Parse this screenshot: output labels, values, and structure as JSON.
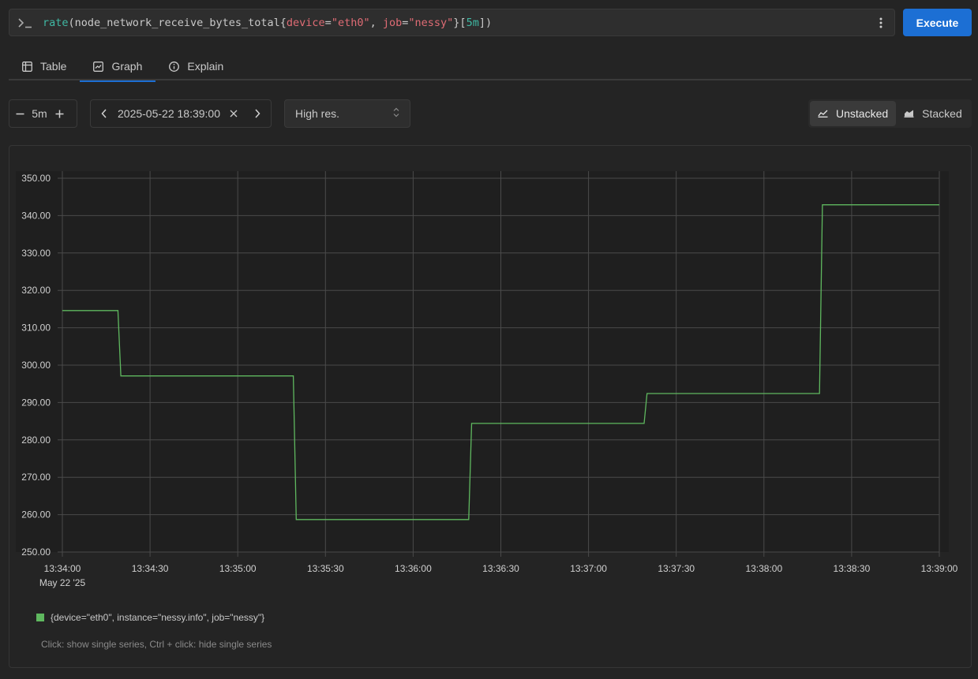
{
  "query": {
    "fn": "rate",
    "metric": "node_network_receive_bytes_total",
    "label1_key": "device",
    "label1_val": "\"eth0\"",
    "label2_key": "job",
    "label2_val": "\"nessy\"",
    "range": "5m"
  },
  "execute_label": "Execute",
  "tabs": [
    {
      "label": "Table",
      "icon": "table-icon"
    },
    {
      "label": "Graph",
      "icon": "chart-icon"
    },
    {
      "label": "Explain",
      "icon": "info-icon"
    }
  ],
  "controls": {
    "range_value": "5m",
    "end_time": "2025-05-22 18:39:00",
    "resolution": "High res.",
    "unstacked_label": "Unstacked",
    "stacked_label": "Stacked"
  },
  "legend": {
    "series_label": "{device=\"eth0\", instance=\"nessy.info\", job=\"nessy\"}",
    "hint": "Click: show single series, Ctrl + click: hide single series"
  },
  "colors": {
    "accent": "#1c6fd4",
    "series": "#5fb85f"
  },
  "chart_data": {
    "type": "line",
    "step": true,
    "x_ticks": [
      "13:34:00",
      "13:34:30",
      "13:35:00",
      "13:35:30",
      "13:36:00",
      "13:36:30",
      "13:37:00",
      "13:37:30",
      "13:38:00",
      "13:38:30",
      "13:39:00"
    ],
    "x_date_label": "May 22 '25",
    "y_ticks": [
      "250.00",
      "260.00",
      "270.00",
      "280.00",
      "290.00",
      "300.00",
      "310.00",
      "320.00",
      "330.00",
      "340.00",
      "350.00"
    ],
    "ylim": [
      250,
      350
    ],
    "xlim": [
      "13:34:00",
      "13:39:00"
    ],
    "grid": true,
    "series": [
      {
        "name": "{device=\"eth0\", instance=\"nessy.info\", job=\"nessy\"}",
        "points": [
          [
            "13:34:00",
            314.6
          ],
          [
            "13:34:19",
            314.6
          ],
          [
            "13:34:20",
            297.1
          ],
          [
            "13:35:19",
            297.1
          ],
          [
            "13:35:20",
            258.7
          ],
          [
            "13:36:19",
            258.7
          ],
          [
            "13:36:20",
            284.4
          ],
          [
            "13:37:19",
            284.4
          ],
          [
            "13:37:20",
            292.4
          ],
          [
            "13:38:19",
            292.4
          ],
          [
            "13:38:20",
            342.9
          ],
          [
            "13:39:00",
            342.9
          ]
        ]
      }
    ]
  }
}
